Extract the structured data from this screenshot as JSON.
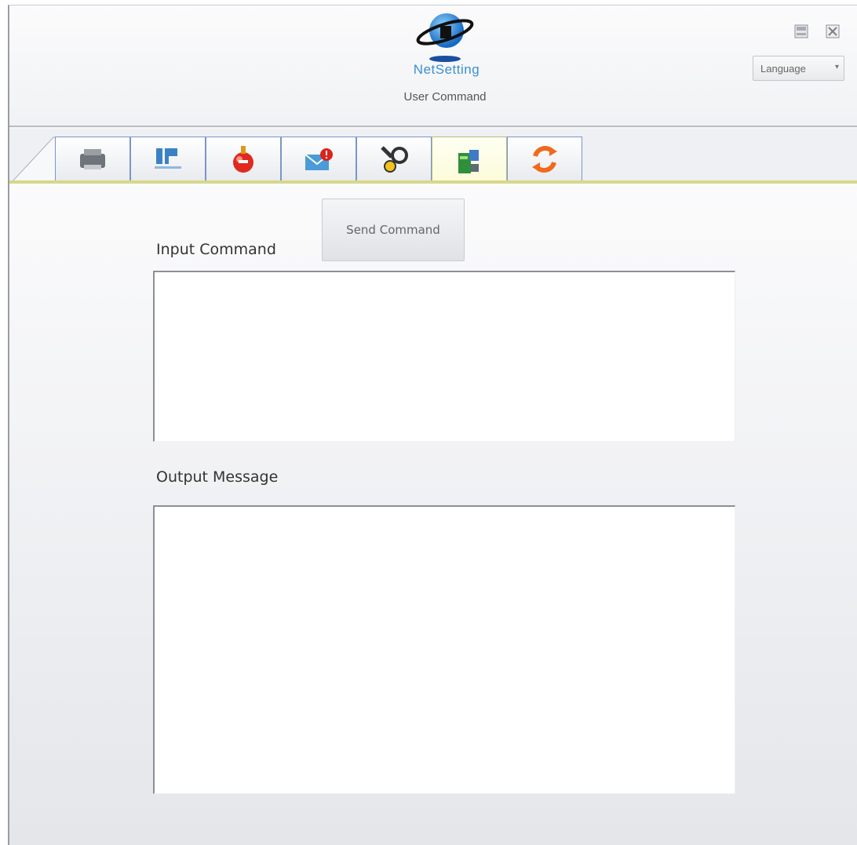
{
  "header": {
    "brand": "NetSetting",
    "subtitle": "User Command",
    "language_label": "Language",
    "language_chevron": "▾"
  },
  "window_controls": [
    "minimize-icon",
    "close-icon"
  ],
  "tabs": [
    {
      "name": "printer-icon",
      "active": false
    },
    {
      "name": "ip-settings-icon",
      "active": false
    },
    {
      "name": "alert-icon",
      "active": false
    },
    {
      "name": "notification-icon",
      "active": false
    },
    {
      "name": "tools-icon",
      "active": false
    },
    {
      "name": "user-command-icon",
      "active": true
    },
    {
      "name": "sync-icon",
      "active": false
    }
  ],
  "main": {
    "send_button": "Send Command",
    "input_label": "Input Command",
    "output_label": "Output Message",
    "input_value": "",
    "output_value": ""
  },
  "colors": {
    "accent_blue": "#3a8fd0",
    "active_tab_underline": "#d7d88a",
    "tab_border": "#7a96c8"
  }
}
